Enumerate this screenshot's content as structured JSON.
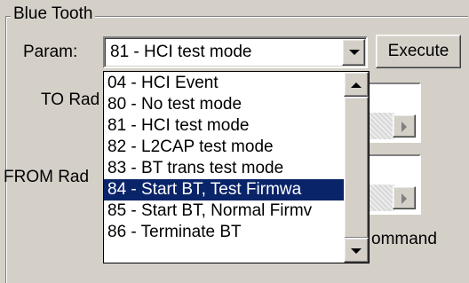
{
  "group": {
    "title": "Blue Tooth"
  },
  "param": {
    "label": "Param:",
    "value": "81 - HCI test mode"
  },
  "execute_label": "Execute",
  "to_radio_label": "TO Rad",
  "from_radio_label": "FROM Rad",
  "command_label": "ommand",
  "dropdown": {
    "items": [
      "04 - HCI Event",
      "80 - No test mode",
      "81 - HCI test mode",
      "82 - L2CAP test mode",
      "83 - BT trans test mode",
      "84 - Start BT, Test Firmwa",
      "85 - Start BT, Normal Firmv",
      "86 - Terminate BT"
    ],
    "selected_index": 5
  },
  "colors": {
    "window": "#d4d0c8",
    "selection": "#0a246a",
    "selection_text": "#ffffff"
  },
  "icons": {
    "combo_button": "chevron-down-icon",
    "scroll_up": "arrow-up-icon",
    "scroll_down": "arrow-down-icon",
    "panel_button": "arrow-right-icon"
  }
}
